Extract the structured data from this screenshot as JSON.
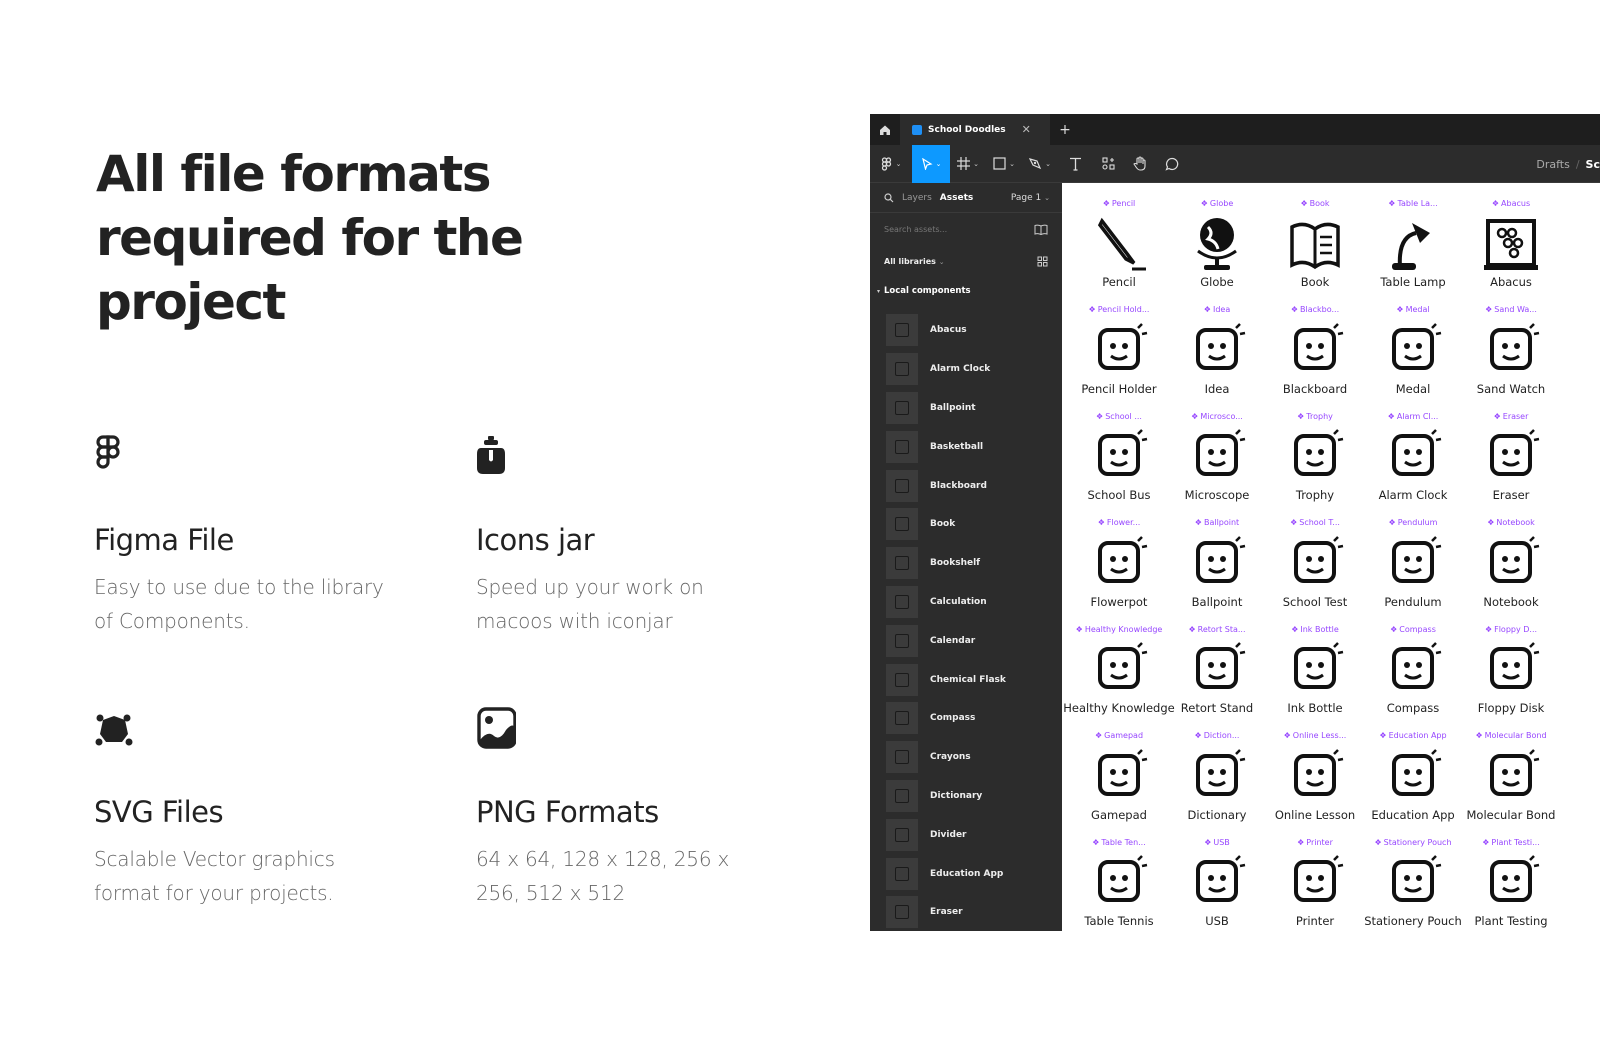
{
  "hero": {
    "title": "All file formats required for the project"
  },
  "features": [
    {
      "id": "figma",
      "icon": "figma-logo-icon",
      "title": "Figma File",
      "description": "Easy to use due to the library of Components."
    },
    {
      "id": "iconjar",
      "icon": "iconjar-icon",
      "title": "Icons jar",
      "description": "Speed up your work on macoos with iconjar"
    },
    {
      "id": "svg",
      "icon": "vector-shape-icon",
      "title": "SVG Files",
      "description": "Scalable Vector graphics format for your projects."
    },
    {
      "id": "png",
      "icon": "image-icon",
      "title": "PNG Formats",
      "description": "64 x 64, 128 x 128, 256 x 256, 512 x 512"
    }
  ],
  "figma": {
    "tab": {
      "title": "School Doodles",
      "close": "✕",
      "add": "+"
    },
    "breadcrumb": {
      "parent": "Drafts",
      "separator": "/",
      "current": "Sc"
    },
    "panel": {
      "tab_layers": "Layers",
      "tab_assets": "Assets",
      "page": "Page 1",
      "search_placeholder": "Search assets...",
      "libraries": "All libraries",
      "section": "Local components",
      "components": [
        "Abacus",
        "Alarm Clock",
        "Ballpoint",
        "Basketball",
        "Blackboard",
        "Book",
        "Bookshelf",
        "Calculation",
        "Calendar",
        "Chemical Flask",
        "Compass",
        "Crayons",
        "Dictionary",
        "Divider",
        "Education App",
        "Eraser"
      ]
    },
    "accent": "#0d99ff",
    "component_color": "#9747ff",
    "canvas_items": [
      {
        "tag": "Pencil",
        "name": "Pencil"
      },
      {
        "tag": "Globe",
        "name": "Globe"
      },
      {
        "tag": "Book",
        "name": "Book"
      },
      {
        "tag": "Table La...",
        "name": "Table Lamp"
      },
      {
        "tag": "Abacus",
        "name": "Abacus"
      },
      {
        "tag": "Pencil Hold...",
        "name": "Pencil Holder"
      },
      {
        "tag": "Idea",
        "name": "Idea"
      },
      {
        "tag": "Blackbo...",
        "name": "Blackboard"
      },
      {
        "tag": "Medal",
        "name": "Medal"
      },
      {
        "tag": "Sand Wa...",
        "name": "Sand Watch"
      },
      {
        "tag": "School ...",
        "name": "School Bus"
      },
      {
        "tag": "Microsco...",
        "name": "Microscope"
      },
      {
        "tag": "Trophy",
        "name": "Trophy"
      },
      {
        "tag": "Alarm Cl...",
        "name": "Alarm Clock"
      },
      {
        "tag": "Eraser",
        "name": "Eraser"
      },
      {
        "tag": "Flower...",
        "name": "Flowerpot"
      },
      {
        "tag": "Ballpoint",
        "name": "Ballpoint"
      },
      {
        "tag": "School T...",
        "name": "School Test"
      },
      {
        "tag": "Pendulum",
        "name": "Pendulum"
      },
      {
        "tag": "Notebook",
        "name": "Notebook"
      },
      {
        "tag": "Healthy Knowledge",
        "name": "Healthy Knowledge"
      },
      {
        "tag": "Retort Sta...",
        "name": "Retort Stand"
      },
      {
        "tag": "Ink Bottle",
        "name": "Ink Bottle"
      },
      {
        "tag": "Compass",
        "name": "Compass"
      },
      {
        "tag": "Floppy D...",
        "name": "Floppy Disk"
      },
      {
        "tag": "Gamepad",
        "name": "Gamepad"
      },
      {
        "tag": "Diction...",
        "name": "Dictionary"
      },
      {
        "tag": "Online Less...",
        "name": "Online Lesson"
      },
      {
        "tag": "Education App",
        "name": "Education App"
      },
      {
        "tag": "Molecular Bond",
        "name": "Molecular Bond"
      },
      {
        "tag": "Table Ten...",
        "name": "Table Tennis"
      },
      {
        "tag": "USB",
        "name": "USB"
      },
      {
        "tag": "Printer",
        "name": "Printer"
      },
      {
        "tag": "Stationery Pouch",
        "name": "Stationery Pouch"
      },
      {
        "tag": "Plant Testi...",
        "name": "Plant Testing"
      }
    ]
  }
}
